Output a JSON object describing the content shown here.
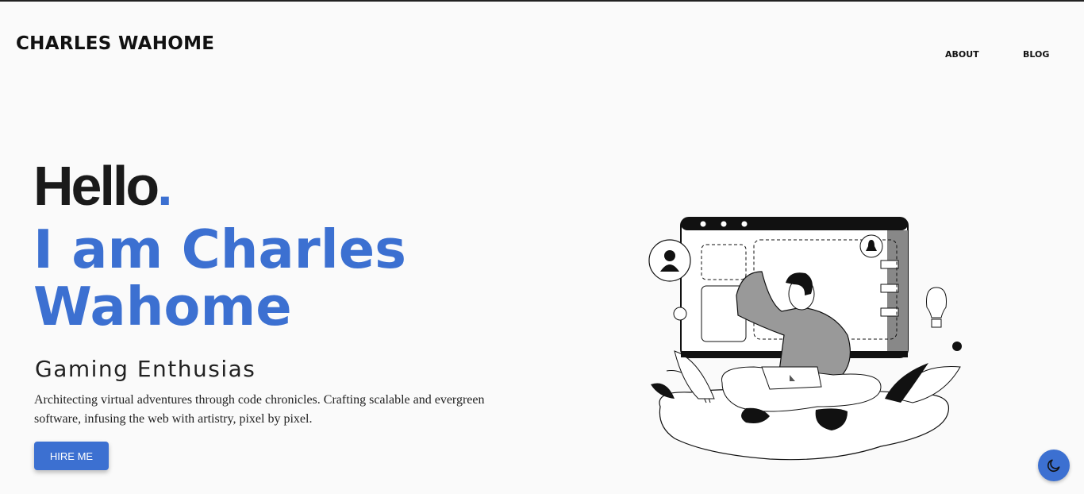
{
  "header": {
    "logo": "CHARLES WAHOME",
    "nav": {
      "about": "ABOUT",
      "blog": "BLOG"
    }
  },
  "hero": {
    "hello": "Hello",
    "hello_dot": ".",
    "name_line1": "I am Charles",
    "name_line2": "Wahome",
    "role": "Gaming Enthusias",
    "description": "Architecting virtual adventures through code chronicles. Crafting scalable and evergreen software, infusing the web with artistry, pixel by pixel.",
    "cta": "HIRE ME"
  },
  "colors": {
    "accent": "#3c70d1",
    "text": "#1a1a1a",
    "background": "#fafafa"
  },
  "icons": {
    "theme_toggle": "moon-icon",
    "illustration": "developer-illustration"
  }
}
